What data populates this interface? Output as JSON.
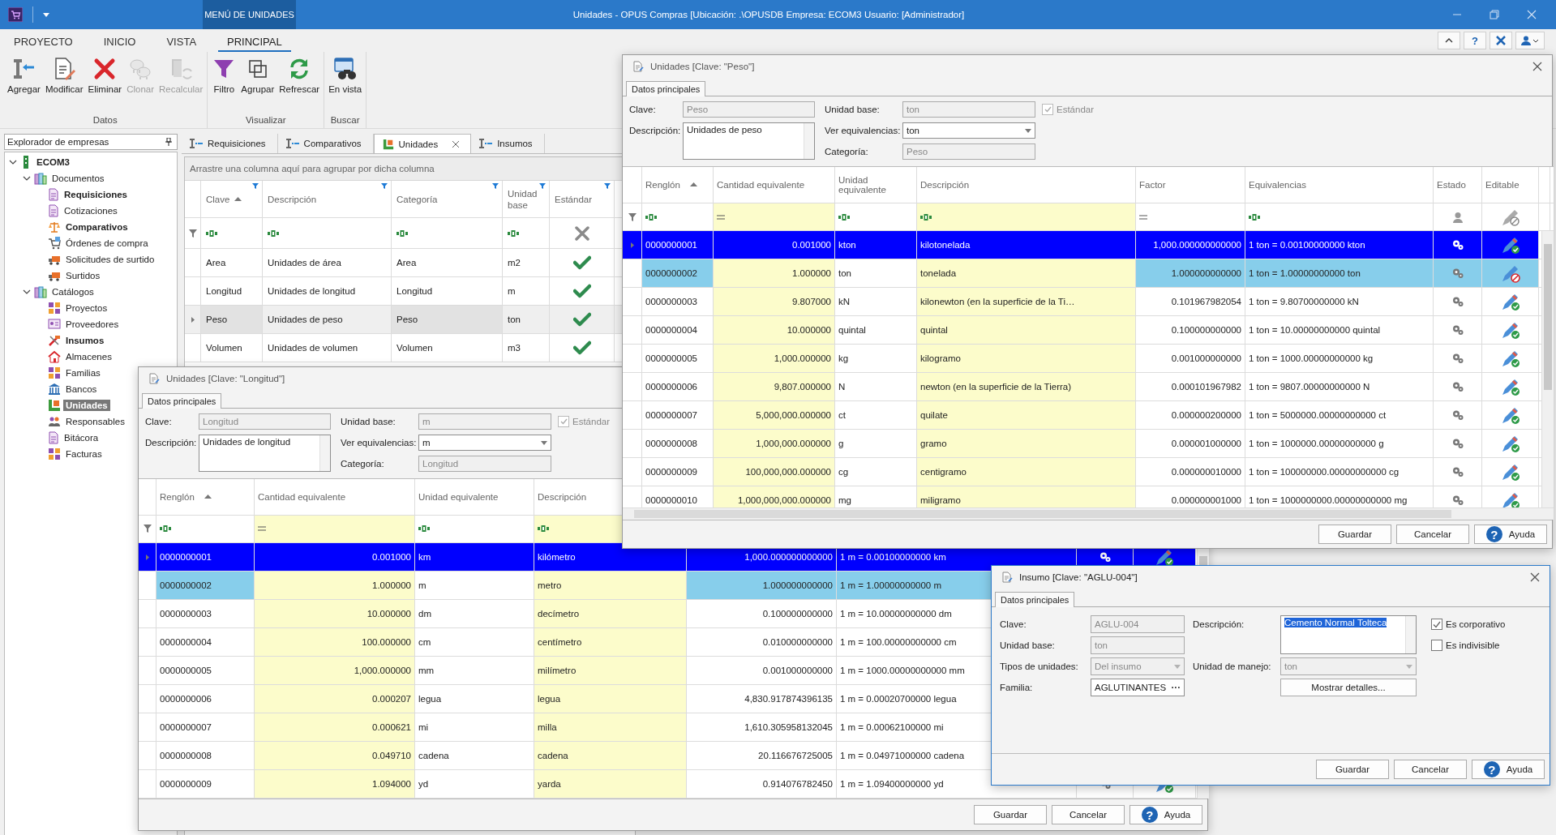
{
  "title_bar": {
    "context_tab": "MENÚ DE UNIDADES",
    "title": "Unidades - OPUS Compras [Ubicación: .\\OPUSDB Empresa: ECOM3 Usuario: [Administrador]"
  },
  "ribbon": {
    "tabs": [
      {
        "label": "PROYECTO",
        "selected": false
      },
      {
        "label": "INICIO",
        "selected": false
      },
      {
        "label": "VISTA",
        "selected": false
      },
      {
        "label": "PRINCIPAL",
        "selected": true
      }
    ],
    "help_char": "?",
    "groups": [
      {
        "label": "Datos",
        "buttons": [
          {
            "label": "Agregar",
            "kind": "add",
            "disabled": false
          },
          {
            "label": "Modificar",
            "kind": "edit",
            "disabled": false
          },
          {
            "label": "Eliminar",
            "kind": "delete",
            "disabled": false
          },
          {
            "label": "Clonar",
            "kind": "clone",
            "disabled": true
          },
          {
            "label": "Recalcular",
            "kind": "recalc",
            "disabled": true
          }
        ]
      },
      {
        "label": "Visualizar",
        "buttons": [
          {
            "label": "Filtro",
            "kind": "filter",
            "disabled": false
          },
          {
            "label": "Agrupar",
            "kind": "group",
            "disabled": false
          },
          {
            "label": "Refrescar",
            "kind": "refresh",
            "disabled": false
          }
        ]
      },
      {
        "label": "Buscar",
        "buttons": [
          {
            "label": "En vista",
            "kind": "view",
            "disabled": false
          }
        ]
      }
    ]
  },
  "explorer": {
    "title": "Explorador de empresas",
    "tree": [
      {
        "label": "ECOM3",
        "kind": "tower",
        "bold": true,
        "selected": false,
        "expanded": true,
        "children": [
          {
            "label": "Documentos",
            "kind": "folder",
            "bold": false,
            "selected": false,
            "expanded": true,
            "children": [
              {
                "label": "Requisiciones",
                "kind": "page",
                "bold": true,
                "selected": false
              },
              {
                "label": "Cotizaciones",
                "kind": "page",
                "bold": false,
                "selected": false
              },
              {
                "label": "Comparativos",
                "kind": "scale",
                "bold": true,
                "selected": false
              },
              {
                "label": "Órdenes de compra",
                "kind": "cart",
                "bold": false,
                "selected": false
              },
              {
                "label": "Solicitudes de surtido",
                "kind": "truck",
                "bold": false,
                "selected": false
              },
              {
                "label": "Surtidos",
                "kind": "truck",
                "bold": false,
                "selected": false
              }
            ]
          },
          {
            "label": "Catálogos",
            "kind": "folder",
            "bold": false,
            "selected": false,
            "expanded": true,
            "children": [
              {
                "label": "Proyectos",
                "kind": "tiles",
                "bold": false,
                "selected": false
              },
              {
                "label": "Proveedores",
                "kind": "card",
                "bold": false,
                "selected": false
              },
              {
                "label": "Insumos",
                "kind": "tools",
                "bold": true,
                "selected": false
              },
              {
                "label": "Almacenes",
                "kind": "house",
                "bold": false,
                "selected": false
              },
              {
                "label": "Familias",
                "kind": "tiles",
                "bold": false,
                "selected": false
              },
              {
                "label": "Bancos",
                "kind": "bank",
                "bold": false,
                "selected": false
              },
              {
                "label": "Unidades",
                "kind": "ruler",
                "bold": true,
                "selected": true
              },
              {
                "label": "Responsables",
                "kind": "people",
                "bold": false,
                "selected": false
              },
              {
                "label": "Bitácora",
                "kind": "page",
                "bold": false,
                "selected": false
              },
              {
                "label": "Facturas",
                "kind": "tiles",
                "bold": false,
                "selected": false
              }
            ]
          }
        ]
      }
    ]
  },
  "document_tabs": [
    {
      "label": "Requisiciones",
      "selected": false,
      "closable": false
    },
    {
      "label": "Comparativos",
      "selected": false,
      "closable": false
    },
    {
      "label": "Unidades",
      "selected": true,
      "closable": true
    },
    {
      "label": "Insumos",
      "selected": false,
      "closable": false
    }
  ],
  "units_grid": {
    "group_hint": "Arrastre una columna aquí para agrupar por dicha columna",
    "columns": [
      {
        "label": "Clave",
        "sorted": true
      },
      {
        "label": "Descripción",
        "sorted": false
      },
      {
        "label": "Categoría",
        "sorted": false
      },
      {
        "label": "Unidad base",
        "sorted": false
      },
      {
        "label": "Estándar",
        "sorted": false
      }
    ],
    "rows": [
      {
        "clave": "Area",
        "descripcion": "Unidades de área",
        "categoria": "Area",
        "unidad_base": "m2",
        "standard": true,
        "selected": false
      },
      {
        "clave": "Longitud",
        "descripcion": "Unidades de longitud",
        "categoria": "Longitud",
        "unidad_base": "m",
        "standard": true,
        "selected": false
      },
      {
        "clave": "Peso",
        "descripcion": "Unidades de peso",
        "categoria": "Peso",
        "unidad_base": "ton",
        "standard": true,
        "selected": true
      },
      {
        "clave": "Volumen",
        "descripcion": "Unidades de volumen",
        "categoria": "Volumen",
        "unidad_base": "m3",
        "standard": true,
        "selected": false
      }
    ]
  },
  "longitud_dialog": {
    "title": "Unidades [Clave: \"Longitud\"]",
    "tab": "Datos principales",
    "form": {
      "clave": {
        "label": "Clave:",
        "value": "Longitud",
        "disabled": true
      },
      "unidad_base": {
        "label": "Unidad base:",
        "value": "m",
        "disabled": true
      },
      "estandar": {
        "label": "Estándar",
        "checked": true
      },
      "descripcion": {
        "label": "Descripción:",
        "value": "Unidades de longitud",
        "disabled": false
      },
      "ver_equivalencias": {
        "label": "Ver equivalencias:",
        "value": "m",
        "disabled": false
      },
      "categoria": {
        "label": "Categoría:",
        "value": "Longitud",
        "disabled": true
      }
    },
    "columns": [
      {
        "label": "Renglón",
        "sorted": true,
        "kind": "text"
      },
      {
        "label": "Cantidad equivalente",
        "sorted": false,
        "kind": "number"
      },
      {
        "label": "Unidad equivalente",
        "sorted": false,
        "kind": "text"
      },
      {
        "label": "Descripción",
        "sorted": false,
        "kind": "text"
      }
    ],
    "rows": [
      {
        "renglon": "0000000001",
        "cantidad": "0.001000",
        "unidad": "km",
        "descripcion": "kilómetro",
        "factor": "1,000.000000000000",
        "equivalencia": "1 m = 0.00100000000 km",
        "selected": true,
        "base": false,
        "editable": true
      },
      {
        "renglon": "0000000002",
        "cantidad": "1.000000",
        "unidad": "m",
        "descripcion": "metro",
        "factor": "1.000000000000",
        "equivalencia": "1 m = 1.00000000000 m",
        "selected": false,
        "base": true
      },
      {
        "renglon": "0000000003",
        "cantidad": "10.000000",
        "unidad": "dm",
        "descripcion": "decímetro",
        "factor": "0.100000000000",
        "equivalencia": "1 m = 10.00000000000 dm",
        "selected": false,
        "base": false
      },
      {
        "renglon": "0000000004",
        "cantidad": "100.000000",
        "unidad": "cm",
        "descripcion": "centímetro",
        "factor": "0.010000000000",
        "equivalencia": "1 m = 100.00000000000 cm",
        "selected": false,
        "base": false
      },
      {
        "renglon": "0000000005",
        "cantidad": "1,000.000000",
        "unidad": "mm",
        "descripcion": "milímetro",
        "factor": "0.001000000000",
        "equivalencia": "1 m = 1000.00000000000 mm",
        "selected": false,
        "base": false
      },
      {
        "renglon": "0000000006",
        "cantidad": "0.000207",
        "unidad": "legua",
        "descripcion": "legua",
        "factor": "4,830.917874396135",
        "equivalencia": "1 m = 0.00020700000 legua",
        "selected": false,
        "base": false
      },
      {
        "renglon": "0000000007",
        "cantidad": "0.000621",
        "unidad": "mi",
        "descripcion": "milla",
        "factor": "1,610.305958132045",
        "equivalencia": "1 m = 0.00062100000 mi",
        "selected": false,
        "base": false
      },
      {
        "renglon": "0000000008",
        "cantidad": "0.049710",
        "unidad": "cadena",
        "descripcion": "cadena",
        "factor": "20.116676725005",
        "equivalencia": "1 m = 0.04971000000 cadena",
        "selected": false,
        "base": false
      },
      {
        "renglon": "0000000009",
        "cantidad": "1.094000",
        "unidad": "yd",
        "descripcion": "yarda",
        "factor": "0.914076782450",
        "equivalencia": "1 m = 1.09400000000 yd",
        "selected": false,
        "base": false,
        "editable": true
      }
    ],
    "buttons": [
      {
        "label": "Guardar",
        "kind": "plain"
      },
      {
        "label": "Cancelar",
        "kind": "plain"
      },
      {
        "label": "Ayuda",
        "kind": "help",
        "icon_char": "?"
      }
    ]
  },
  "peso_dialog": {
    "title": "Unidades [Clave: \"Peso\"]",
    "tab": "Datos principales",
    "form": {
      "clave": {
        "label": "Clave:",
        "value": "Peso",
        "disabled": true
      },
      "unidad_base": {
        "label": "Unidad base:",
        "value": "ton",
        "disabled": true
      },
      "estandar": {
        "label": "Estándar",
        "checked": true
      },
      "descripcion": {
        "label": "Descripción:",
        "value": "Unidades de peso",
        "disabled": false
      },
      "ver_equivalencias": {
        "label": "Ver equivalencias:",
        "value": "ton",
        "disabled": false
      },
      "categoria": {
        "label": "Categoría:",
        "value": "Peso",
        "disabled": true
      }
    },
    "columns": [
      {
        "label": "Renglón",
        "sorted": true,
        "kind": "text"
      },
      {
        "label": "Cantidad equivalente",
        "sorted": false,
        "kind": "number"
      },
      {
        "label": "Unidad equivalente",
        "sorted": false,
        "kind": "text"
      },
      {
        "label": "Descripción",
        "sorted": false,
        "kind": "text"
      },
      {
        "label": "Factor",
        "sorted": false,
        "kind": "number"
      },
      {
        "label": "Equivalencias",
        "sorted": false,
        "kind": "text"
      },
      {
        "label": "Estado",
        "sorted": false,
        "kind": "status"
      },
      {
        "label": "Editable",
        "sorted": false,
        "kind": "editable"
      }
    ],
    "rows": [
      {
        "renglon": "0000000001",
        "cantidad": "0.001000",
        "unidad": "kton",
        "descripcion": "kilotonelada",
        "factor": "1,000.000000000000",
        "equivalencia": "1 ton = 0.00100000000 kton",
        "selected": true,
        "base": false,
        "editable": true
      },
      {
        "renglon": "0000000002",
        "cantidad": "1.000000",
        "unidad": "ton",
        "descripcion": "tonelada",
        "factor": "1.000000000000",
        "equivalencia": "1 ton = 1.00000000000 ton",
        "selected": false,
        "base": true,
        "editable": false
      },
      {
        "renglon": "0000000003",
        "cantidad": "9.807000",
        "unidad": "kN",
        "descripcion": "kilonewton (en la superficie de la Ti…",
        "factor": "0.101967982054",
        "equivalencia": "1 ton = 9.80700000000 kN",
        "selected": false,
        "base": false,
        "editable": true
      },
      {
        "renglon": "0000000004",
        "cantidad": "10.000000",
        "unidad": "quintal",
        "descripcion": "quintal",
        "factor": "0.100000000000",
        "equivalencia": "1 ton = 10.00000000000 quintal",
        "selected": false,
        "base": false,
        "editable": true
      },
      {
        "renglon": "0000000005",
        "cantidad": "1,000.000000",
        "unidad": "kg",
        "descripcion": "kilogramo",
        "factor": "0.001000000000",
        "equivalencia": "1 ton = 1000.00000000000 kg",
        "selected": false,
        "base": false,
        "editable": true
      },
      {
        "renglon": "0000000006",
        "cantidad": "9,807.000000",
        "unidad": "N",
        "descripcion": "newton (en la superficie de la Tierra)",
        "factor": "0.000101967982",
        "equivalencia": "1 ton = 9807.00000000000 N",
        "selected": false,
        "base": false,
        "editable": true
      },
      {
        "renglon": "0000000007",
        "cantidad": "5,000,000.000000",
        "unidad": "ct",
        "descripcion": "quilate",
        "factor": "0.000000200000",
        "equivalencia": "1 ton = 5000000.00000000000 ct",
        "selected": false,
        "base": false,
        "editable": true
      },
      {
        "renglon": "0000000008",
        "cantidad": "1,000,000.000000",
        "unidad": "g",
        "descripcion": "gramo",
        "factor": "0.000001000000",
        "equivalencia": "1 ton = 1000000.00000000000 g",
        "selected": false,
        "base": false,
        "editable": true
      },
      {
        "renglon": "0000000009",
        "cantidad": "100,000,000.000000",
        "unidad": "cg",
        "descripcion": "centigramo",
        "factor": "0.000000010000",
        "equivalencia": "1 ton = 100000000.00000000000 cg",
        "selected": false,
        "base": false,
        "editable": true
      },
      {
        "renglon": "0000000010",
        "cantidad": "1,000,000,000.000000",
        "unidad": "mg",
        "descripcion": "miligramo",
        "factor": "0.000000001000",
        "equivalencia": "1 ton = 1000000000.00000000000 mg",
        "selected": false,
        "base": false,
        "editable": true
      }
    ],
    "buttons": [
      {
        "label": "Guardar",
        "kind": "plain"
      },
      {
        "label": "Cancelar",
        "kind": "plain"
      },
      {
        "label": "Ayuda",
        "kind": "help",
        "icon_char": "?"
      }
    ]
  },
  "insumo_dialog": {
    "title": "Insumo [Clave: \"AGLU-004\"]",
    "tab": "Datos principales",
    "fields": {
      "clave": {
        "label": "Clave:",
        "value": "AGLU-004",
        "disabled": true
      },
      "unidad_base": {
        "label": "Unidad base:",
        "value": "ton",
        "disabled": true
      },
      "tipos": {
        "label": "Tipos de unidades:",
        "value": "Del insumo",
        "disabled": true
      },
      "familia": {
        "label": "Familia:",
        "value": "AGLUTINANTES",
        "browse": "···",
        "disabled": false
      },
      "descripcion": {
        "label": "Descripción:",
        "value": "Cemento Normal Tolteca",
        "text_selected": true
      },
      "unidad_manejo": {
        "label": "Unidad de manejo:",
        "value": "ton",
        "disabled": true
      }
    },
    "details_button": "Mostrar detalles...",
    "checkboxes": [
      {
        "label": "Es corporativo",
        "checked": true
      },
      {
        "label": "Es indivisible",
        "checked": false
      }
    ],
    "buttons": [
      {
        "label": "Guardar",
        "kind": "plain"
      },
      {
        "label": "Cancelar",
        "kind": "plain"
      },
      {
        "label": "Ayuda",
        "kind": "help",
        "icon_char": "?"
      }
    ]
  }
}
